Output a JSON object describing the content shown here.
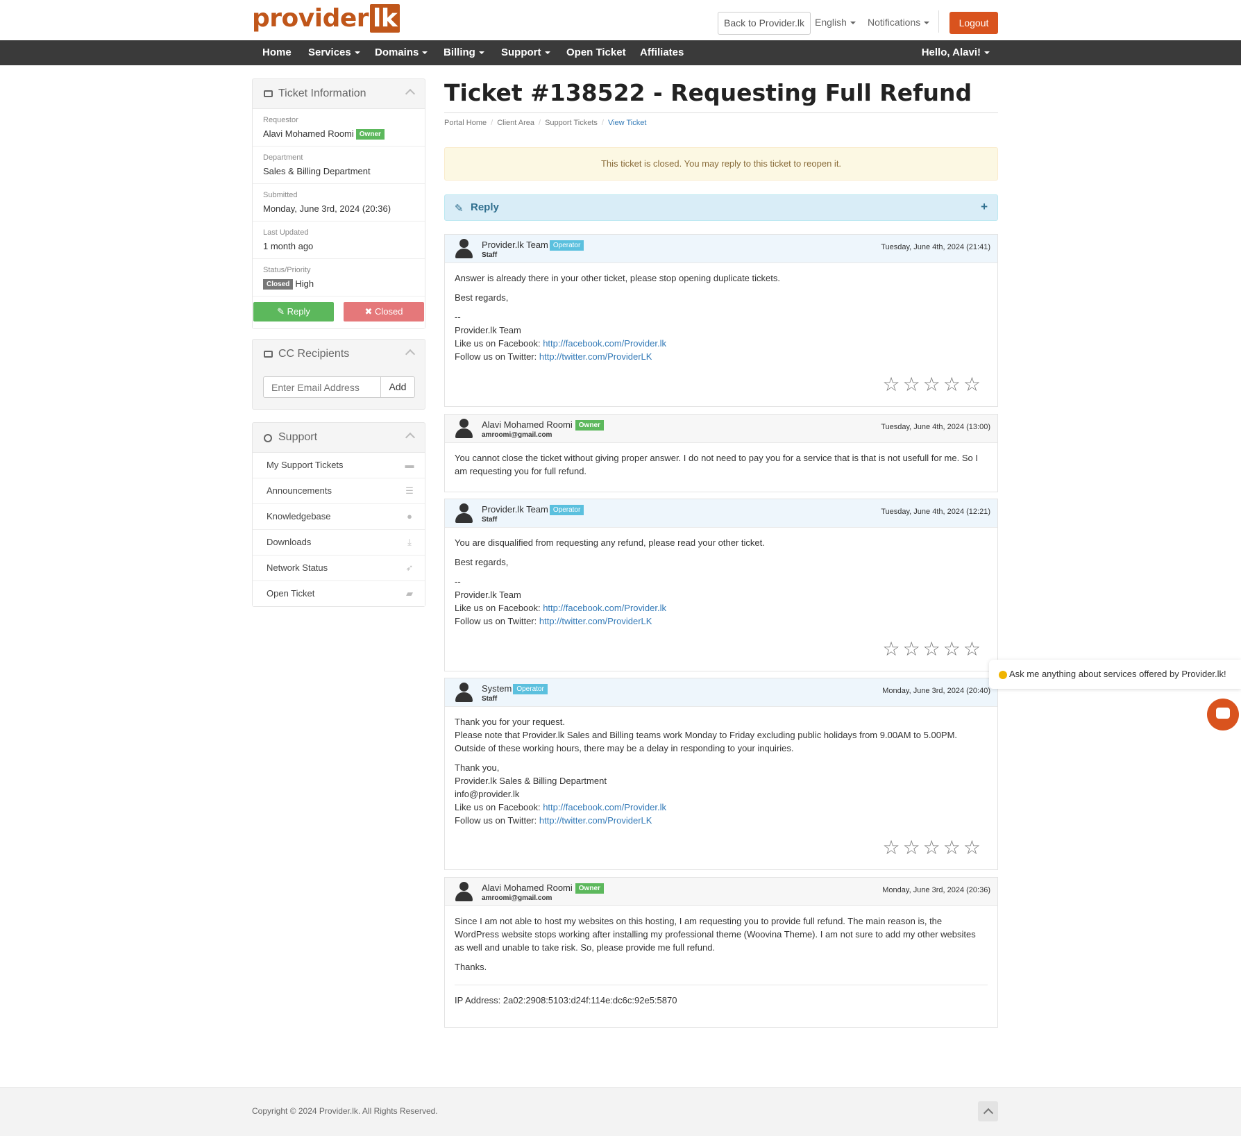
{
  "header": {
    "logo_main": "provider",
    "logo_suffix": "lk",
    "back_button": "Back to Provider.lk",
    "language": "English",
    "notifications": "Notifications",
    "logout": "Logout"
  },
  "nav": {
    "items": [
      "Home",
      "Services",
      "Domains",
      "Billing",
      "Support",
      "Open Ticket",
      "Affiliates"
    ],
    "user": "Hello, Alavi!"
  },
  "sidebar": {
    "ticket_info": {
      "title": "Ticket Information",
      "requestor_label": "Requestor",
      "requestor_value": "Alavi Mohamed Roomi",
      "requestor_badge": "Owner",
      "department_label": "Department",
      "department_value": "Sales & Billing Department",
      "submitted_label": "Submitted",
      "submitted_value": "Monday, June 3rd, 2024 (20:36)",
      "updated_label": "Last Updated",
      "updated_value": "1 month ago",
      "status_label": "Status/Priority",
      "status_badge": "Closed",
      "priority_value": "High",
      "reply_button": "Reply",
      "closed_button": "Closed"
    },
    "cc": {
      "title": "CC Recipients",
      "placeholder": "Enter Email Address",
      "add_button": "Add"
    },
    "support": {
      "title": "Support",
      "items": [
        "My Support Tickets",
        "Announcements",
        "Knowledgebase",
        "Downloads",
        "Network Status",
        "Open Ticket"
      ]
    }
  },
  "main": {
    "title": "Ticket #138522 - Requesting Full Refund",
    "breadcrumb": [
      "Portal Home",
      "Client Area",
      "Support Tickets",
      "View Ticket"
    ],
    "alert": "This ticket is closed. You may reply to this ticket to reopen it.",
    "reply_label": "Reply",
    "reply_plus": "+",
    "messages": [
      {
        "name": "Provider.lk Team",
        "badge": "Operator",
        "sub": "Staff",
        "date": "Tuesday, June 4th, 2024 (21:41)",
        "p1": "Answer is already there in your other ticket, please stop opening duplicate tickets.",
        "p2": "Best regards,",
        "dash": "--",
        "team": "Provider.lk Team",
        "fb_label": "Like us on Facebook: ",
        "fb_link": "http://facebook.com/Provider.lk",
        "tw_label": "Follow us on Twitter: ",
        "tw_link": "http://twitter.com/ProviderLK"
      },
      {
        "name": "Alavi Mohamed Roomi",
        "badge": "Owner",
        "sub": "amroomi@gmail.com",
        "date": "Tuesday, June 4th, 2024 (13:00)",
        "p1": "You cannot close the ticket without giving proper answer. I do not need to pay you for a service that is that is not usefull for me. So I am requesting you for full refund."
      },
      {
        "name": "Provider.lk Team",
        "badge": "Operator",
        "sub": "Staff",
        "date": "Tuesday, June 4th, 2024 (12:21)",
        "p1": "You are disqualified from requesting any refund, please read your other ticket.",
        "p2": "Best regards,",
        "dash": "--",
        "team": "Provider.lk Team",
        "fb_label": "Like us on Facebook: ",
        "fb_link": "http://facebook.com/Provider.lk",
        "tw_label": "Follow us on Twitter: ",
        "tw_link": "http://twitter.com/ProviderLK"
      },
      {
        "name": "System",
        "badge": "Operator",
        "sub": "Staff",
        "date": "Monday, June 3rd, 2024 (20:40)",
        "p1": "Thank you for your request.",
        "p1b": "Please note that Provider.lk Sales and Billing teams work Monday to Friday excluding public holidays from 9.00AM to 5.00PM. Outside of these working hours, there may be a delay in responding to your inquiries.",
        "p2": "Thank you,",
        "team": "Provider.lk Sales & Billing Department",
        "email": "info@provider.lk",
        "fb_label": "Like us on Facebook: ",
        "fb_link": "http://facebook.com/Provider.lk",
        "tw_label": "Follow us on Twitter: ",
        "tw_link": "http://twitter.com/ProviderLK"
      },
      {
        "name": "Alavi Mohamed Roomi",
        "badge": "Owner",
        "sub": "amroomi@gmail.com",
        "date": "Monday, June 3rd, 2024 (20:36)",
        "p1": "Since I am not able to host my websites on this hosting, I am requesting you to provide full refund. The main reason is, the WordPress website stops working after installing my professional theme (Woovina Theme). I am not sure to add my other websites as well and unable to take risk. So, please provide me full refund.",
        "p2": "Thanks.",
        "ip": "IP Address: 2a02:2908:5103:d24f:114e:dc6c:92e5:5870"
      }
    ]
  },
  "chat": {
    "prompt": "Ask me anything about services offered by Provider.lk!"
  },
  "footer": {
    "copyright": "Copyright © 2024 Provider.lk. All Rights Reserved."
  },
  "colors": {
    "brand_orange": "#d9531e",
    "nav_dark": "#3a3a3a",
    "success_green": "#5cb85c",
    "danger_light": "#e5787a",
    "info_blue": "#5bc0de",
    "link_blue": "#337ab7"
  },
  "icons": {
    "ticket": "ticket-icon",
    "cc": "address-card-icon",
    "support": "life-ring-icon",
    "reply": "pencil-icon",
    "close": "times-icon",
    "star": "star-outline-icon",
    "chat": "chat-bubble-icon"
  }
}
